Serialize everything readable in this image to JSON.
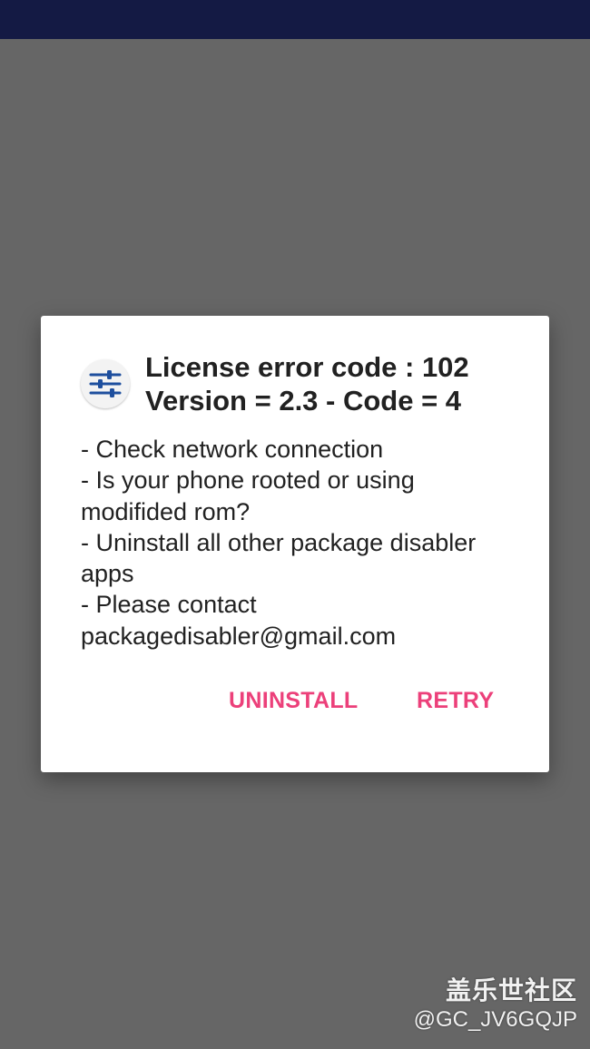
{
  "dialog": {
    "title_line1": "License error code : 102",
    "title_line2": "Version = 2.3 - Code = 4",
    "message_lines": [
      "- Check network connection",
      "- Is your phone rooted or using",
      "modifided rom?",
      "- Uninstall all other package disabler",
      "apps",
      "- Please contact",
      "packagedisabler@gmail.com"
    ],
    "buttons": {
      "uninstall": "UNINSTALL",
      "retry": "RETRY"
    },
    "icon": "sliders-icon"
  },
  "watermark": {
    "brand": "盖乐世社区",
    "user": "@GC_JV6GQJP"
  },
  "colors": {
    "status_bar": "#141a44",
    "scrim": "#666666",
    "accent": "#ec407a",
    "icon_blue": "#1e4f9e"
  }
}
